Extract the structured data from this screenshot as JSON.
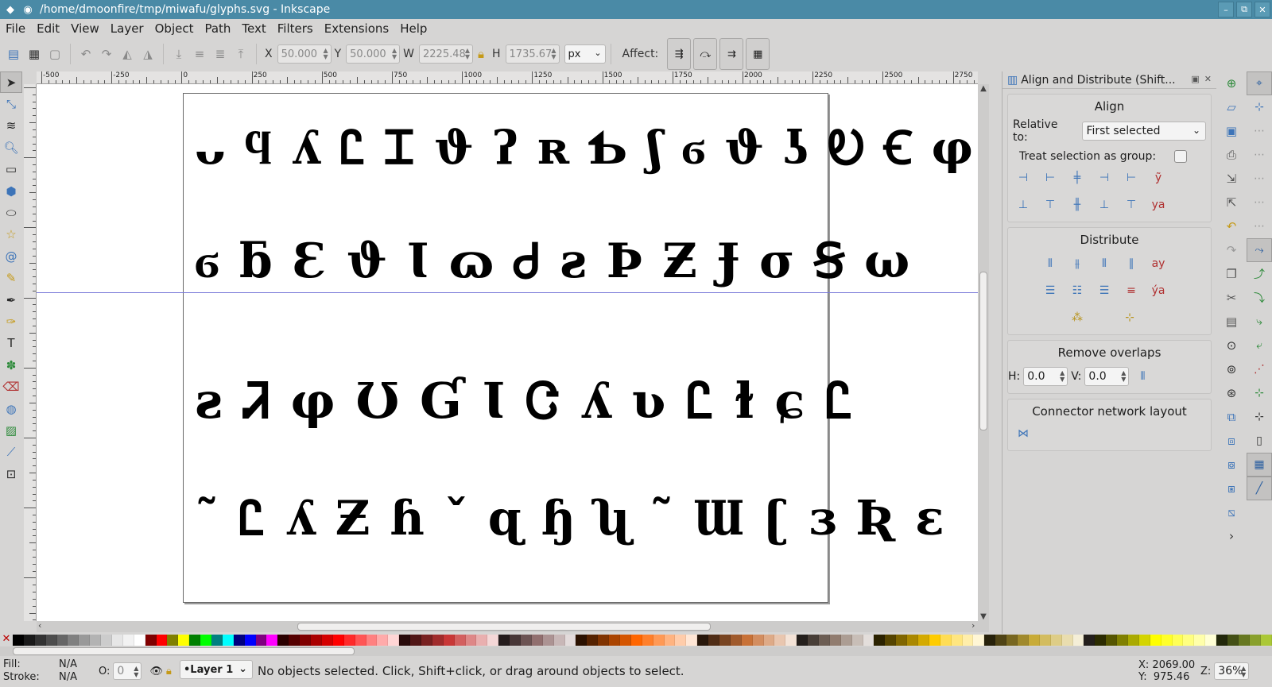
{
  "window": {
    "title": "/home/dmoonfire/tmp/miwafu/glyphs.svg - Inkscape",
    "buttons": [
      "–",
      "⧉",
      "✕"
    ]
  },
  "menu": [
    "File",
    "Edit",
    "View",
    "Layer",
    "Object",
    "Path",
    "Text",
    "Filters",
    "Extensions",
    "Help"
  ],
  "toolbar": {
    "x_label": "X",
    "x_value": "50.000",
    "y_label": "Y",
    "y_value": "50.000",
    "w_label": "W",
    "w_value": "2225.48",
    "h_label": "H",
    "h_value": "1735.67",
    "unit": "px",
    "affect_label": "Affect:"
  },
  "ruler": {
    "labels": [
      "-500",
      "-250",
      "0",
      "250",
      "500",
      "750",
      "1000",
      "1250",
      "1500",
      "1750",
      "2000",
      "2250",
      "2500",
      "2750"
    ]
  },
  "glyphs": {
    "rows": [
      "ᴗ ϥ ʎ Ꮭ Ꮖ ϑ ʔ ʀ Ƅ ʃ ϭ ϑ ʖ Ꭷ Ꞓ φ",
      "ϭ ƃ Ɛ ϑ Ɩ ɷ Ꮷ ƨ Ϸ Ƶ Ɉ σ Ꞩ ω",
      "ƨ Ꮨ φ Ʊ Ɠ Ɩ Ꮳ ʎ ʋ Ꮭ ɫ ɕ Ꮭ",
      "˜ Ꮭ ʎ Ƶ ɦ ˇ ɋ ɧ ʯ ˜ Ɯ ʗ ɜ Ʀ ɛ"
    ]
  },
  "dock": {
    "title": "Align and Distribute (Shift...",
    "align_title": "Align",
    "relative_label": "Relative to:",
    "relative_value": "First selected",
    "group_label": "Treat selection as group:",
    "distribute_title": "Distribute",
    "overlap_title": "Remove overlaps",
    "h_label": "H:",
    "h_value": "0.0",
    "v_label": "V:",
    "v_value": "0.0",
    "connector_title": "Connector network layout"
  },
  "status": {
    "fill_label": "Fill:",
    "fill_value": "N/A",
    "stroke_label": "Stroke:",
    "stroke_value": "N/A",
    "opacity_label": "O:",
    "opacity_value": "0",
    "layer": "•Layer 1",
    "message": "No objects selected. Click, Shift+click, or drag around objects to select.",
    "x_coord": "X: 2069.00",
    "y_coord": "Y:  975.46",
    "zoom_label": "Z:",
    "zoom_value": "36%"
  },
  "palette_colors": [
    "#000000",
    "#1a1a1a",
    "#333333",
    "#4d4d4d",
    "#666666",
    "#808080",
    "#999999",
    "#b3b3b3",
    "#cccccc",
    "#e6e6e6",
    "#f2f2f2",
    "#ffffff",
    "#800000",
    "#ff0000",
    "#808000",
    "#ffff00",
    "#008000",
    "#00ff00",
    "#008080",
    "#00ffff",
    "#000080",
    "#0000ff",
    "#800080",
    "#ff00ff",
    "#2b0000",
    "#550000",
    "#800000",
    "#aa0000",
    "#d40000",
    "#ff0000",
    "#ff2a2a",
    "#ff5555",
    "#ff8080",
    "#ffaaaa",
    "#ffd5d5",
    "#280b0b",
    "#501616",
    "#782121",
    "#a02c2c",
    "#c83737",
    "#d35f5f",
    "#de8787",
    "#e9afaf",
    "#f4d7d7",
    "#241c1c",
    "#483737",
    "#6c5353",
    "#916f6f",
    "#ac9393",
    "#c8b7b7",
    "#e3dbdb",
    "#2b1100",
    "#552200",
    "#803300",
    "#aa4400",
    "#d45500",
    "#ff6600",
    "#ff7f2a",
    "#ff9955",
    "#ffb380",
    "#ffccaa",
    "#ffe6d5",
    "#28170b",
    "#502d16",
    "#784421",
    "#a05a2c",
    "#c87137",
    "#d38d5f",
    "#deaa87",
    "#e9c6af",
    "#f4e3d7",
    "#241f1c",
    "#483e37",
    "#6c5d53",
    "#917c6f",
    "#ac9d93",
    "#c8beb7",
    "#e3dedb",
    "#2b2200",
    "#554400",
    "#806600",
    "#aa8800",
    "#d4aa00",
    "#ffcc00",
    "#ffdd55",
    "#ffe680",
    "#ffeeaa",
    "#fff6d5",
    "#28220b",
    "#504416",
    "#786721",
    "#a0892c",
    "#c8ab37",
    "#d3bc5f",
    "#decd87",
    "#e9ddaf",
    "#f4eed7",
    "#241f1c",
    "#2b2b00",
    "#555500",
    "#808000",
    "#aaaa00",
    "#d4d400",
    "#ffff00",
    "#ffff2a",
    "#ffff55",
    "#ffff80",
    "#ffffaa",
    "#ffffd5",
    "#22280b",
    "#445016",
    "#677821",
    "#89a02c",
    "#abc837"
  ]
}
